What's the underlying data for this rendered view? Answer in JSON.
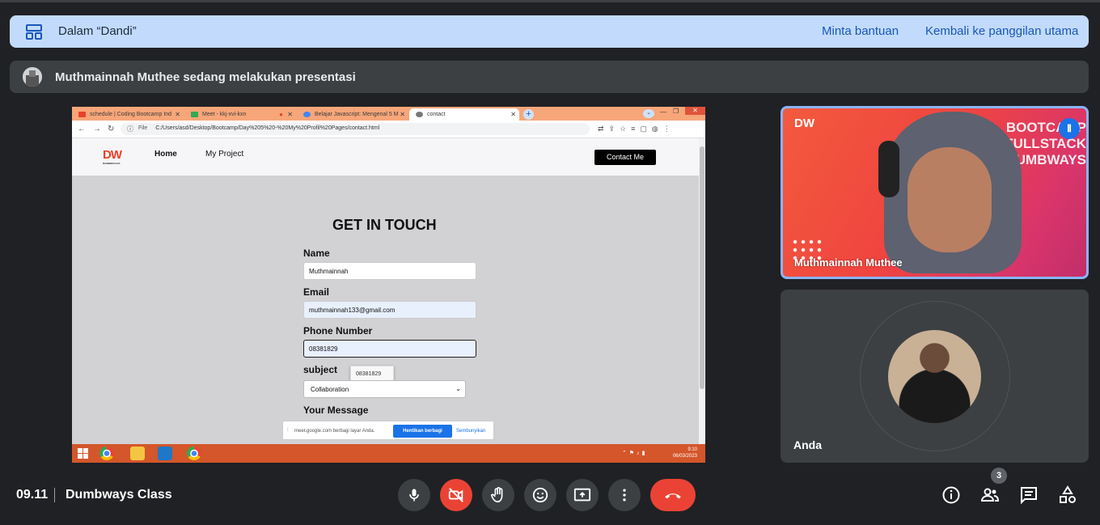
{
  "banner": {
    "title": "Dalam “Dandi”",
    "help_link": "Minta bantuan",
    "back_link": "Kembali ke panggilan utama"
  },
  "presenting": {
    "text": "Muthmainnah Muthee sedang melakukan presentasi"
  },
  "shared_screen": {
    "tabs": [
      {
        "label": "schedule | Coding Bootcamp Ind"
      },
      {
        "label": "Meet - kkj-xvi-kxn"
      },
      {
        "label": "Belajar Javascript: Mengenal 5 M"
      },
      {
        "label": "contact"
      }
    ],
    "address": {
      "scheme": "File",
      "url": "C:/Users/asd/Desktop/Bootcamp/Day%205%20-%20My%20Profil%20Pages/contact.html"
    },
    "site": {
      "logo": "DW",
      "logo_sub": "DUMBWAYS.ID",
      "nav_home": "Home",
      "nav_project": "My Project",
      "contact_button": "Contact Me"
    },
    "form": {
      "title": "GET IN TOUCH",
      "name_label": "Name",
      "name_value": "Muthmainnah",
      "email_label": "Email",
      "email_value": "muthmainnah133@gmail.com",
      "phone_label": "Phone Number",
      "phone_value": "08381829",
      "autofill_suggestion": "08381829",
      "subject_label": "subject",
      "subject_value": "Collaboration",
      "message_label": "Your Message"
    },
    "share_bar": {
      "text": "meet.google.com berbagi layar Anda.",
      "stop_button": "Hentikan berbagi",
      "hide_button": "Sembunyikan"
    },
    "taskbar": {
      "time": "9:10",
      "date": "06/03/2023"
    }
  },
  "participants": [
    {
      "name": "Muthmainnah Muthee",
      "speaking": true,
      "background_text": "BOOTCAMP FULLSTACK DUMBWAYS",
      "logo": "DW"
    },
    {
      "name": "Anda"
    }
  ],
  "bottom_bar": {
    "time": "09.11",
    "meeting_name": "Dumbways Class",
    "people_count": "3"
  },
  "colors": {
    "banner_bg": "#c2dbfc",
    "end_call": "#ea4335",
    "accent": "#8ab4f8"
  }
}
